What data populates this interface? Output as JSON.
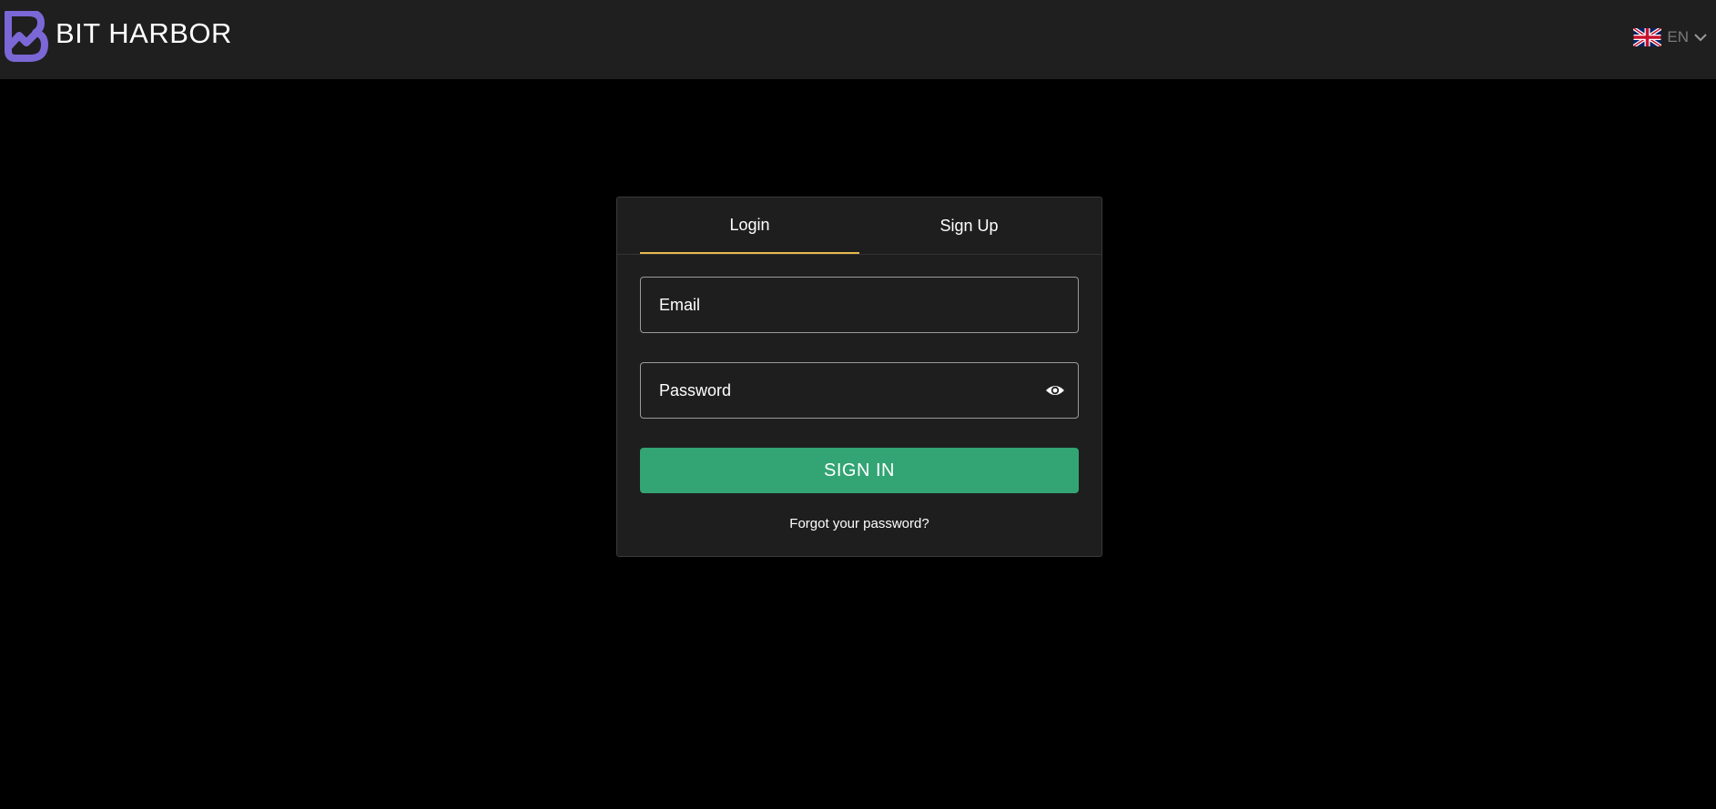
{
  "header": {
    "brand_name": "BIT HARBOR",
    "logo_icon": "bit-harbor-logo-icon",
    "language": {
      "flag_icon": "uk-flag-icon",
      "code": "EN",
      "chevron_icon": "chevron-down-icon"
    }
  },
  "auth": {
    "tabs": [
      {
        "label": "Login",
        "active": true
      },
      {
        "label": "Sign Up",
        "active": false
      }
    ],
    "email": {
      "placeholder": "Email",
      "value": ""
    },
    "password": {
      "placeholder": "Password",
      "value": "",
      "toggle_icon": "eye-icon"
    },
    "submit_label": "SIGN IN",
    "forgot_label": "Forgot your password?"
  },
  "colors": {
    "header_bg": "#1f1f1f",
    "page_bg": "#000000",
    "card_bg": "#1e1e1e",
    "accent_tab": "#e7b94c",
    "primary_button": "#33a474",
    "logo": "#7b68d6"
  }
}
